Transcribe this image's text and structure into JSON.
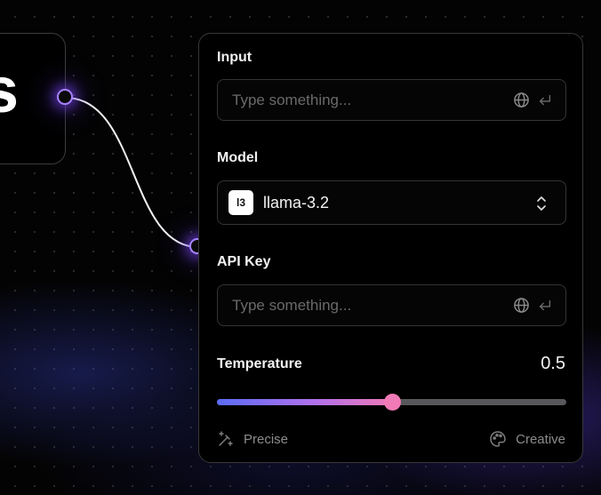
{
  "left_node": {
    "label_fragment": "s"
  },
  "panel": {
    "input": {
      "label": "Input",
      "placeholder": "Type something...",
      "value": ""
    },
    "model": {
      "label": "Model",
      "badge": "l3",
      "selected": "llama-3.2"
    },
    "api_key": {
      "label": "API Key",
      "placeholder": "Type something...",
      "value": ""
    },
    "temperature": {
      "label": "Temperature",
      "value": "0.5",
      "fraction": 0.5,
      "min_label": "Precise",
      "max_label": "Creative"
    }
  },
  "colors": {
    "port_accent": "#a783ff",
    "slider_start": "#5b6cf5",
    "slider_end": "#ef79b6",
    "background": "#030303"
  },
  "icons": {
    "field_globe": "globe-icon",
    "field_enter": "enter-icon",
    "model_toggle": "chevron-up-down-icon",
    "precise": "sparkle-wand-icon",
    "creative": "palette-icon"
  }
}
